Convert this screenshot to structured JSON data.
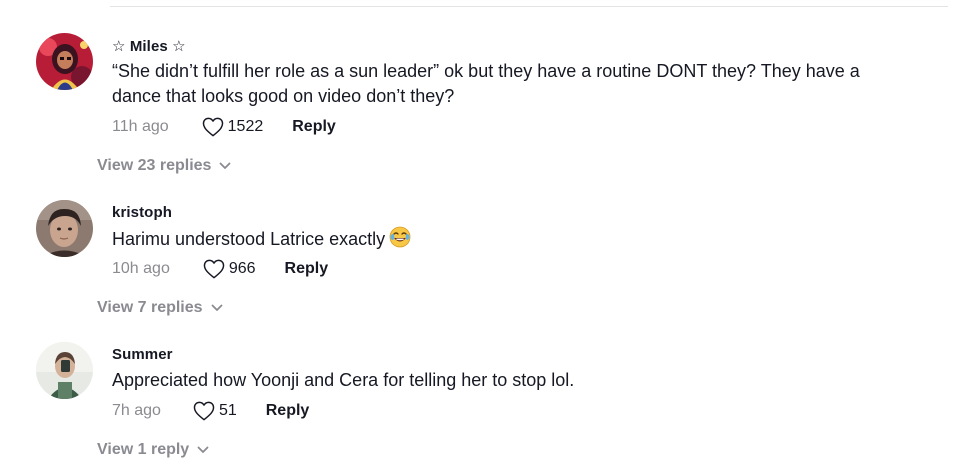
{
  "comments": [
    {
      "username": "☆ Miles ☆",
      "text": "“She didn’t fulfill her role as a sun leader” ok but they have a routine DONT they? They have a dance that looks good on video don’t they?",
      "timestamp": "11h ago",
      "likes": "1522",
      "reply_label": "Reply",
      "view_replies": "View 23 replies",
      "avatar_colors": [
        "#d8283c",
        "#5a1f2e",
        "#f0c34a"
      ]
    },
    {
      "username": "kristoph",
      "text": "Harimu understood Latrice exactly",
      "emoji": "laughing-tears-emoji",
      "timestamp": "10h ago",
      "likes": "966",
      "reply_label": "Reply",
      "view_replies": "View 7 replies",
      "avatar_colors": [
        "#6b5a52",
        "#b79a86",
        "#3a2c28"
      ]
    },
    {
      "username": "Summer",
      "text": "Appreciated how Yoonji and Cera for telling her to stop lol.",
      "timestamp": "7h ago",
      "likes": "51",
      "reply_label": "Reply",
      "view_replies": "View 1 reply",
      "avatar_colors": [
        "#dfe4e0",
        "#3d5c47",
        "#c9a892"
      ]
    }
  ],
  "colors": {
    "primary_text": "#161823",
    "secondary_text": "#8a8b91",
    "divider": "#e3e3e4"
  },
  "icons": {
    "like": "heart-outline-icon",
    "expand": "chevron-down-icon"
  }
}
